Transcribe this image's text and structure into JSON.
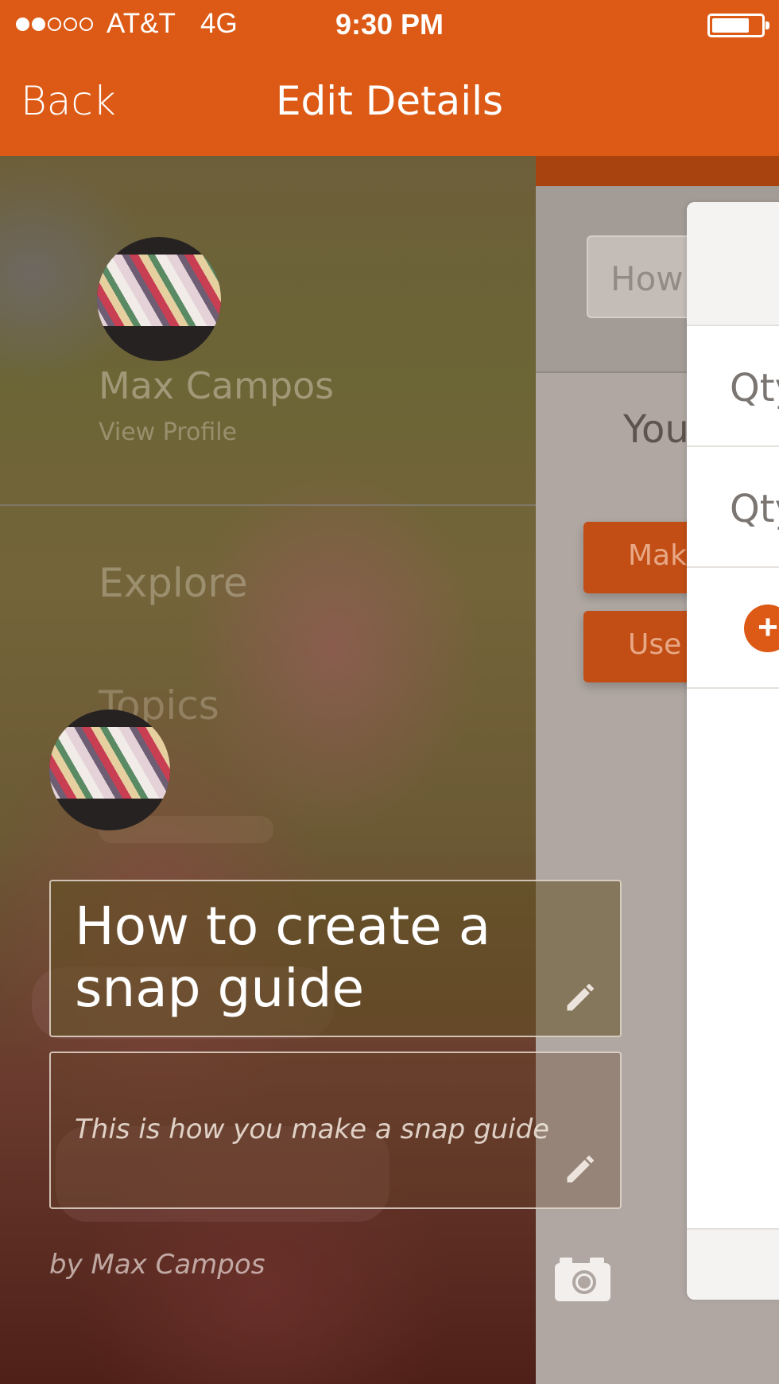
{
  "status_bar": {
    "carrier": "AT&T",
    "network": "4G",
    "time": "9:30 PM",
    "battery_icon": "battery-icon",
    "signal_icon": "signal-dots-icon"
  },
  "nav": {
    "back_label": "Back",
    "title": "Edit Details"
  },
  "drawer": {
    "user_name": "Max Campos",
    "view_profile": "View Profile",
    "items": [
      {
        "label": "Explore"
      },
      {
        "label": "Topics"
      }
    ]
  },
  "underlay": {
    "search_placeholder": "How",
    "partial_text": "You",
    "button_make": "Make",
    "button_use": "Use"
  },
  "panel": {
    "rows": [
      {
        "label": "Qty"
      },
      {
        "label": "Qty"
      }
    ],
    "add_icon": "plus-circle-icon"
  },
  "edit": {
    "title_value": "How to create  a snap guide",
    "description_value": "This is how you make a snap guide",
    "byline": "by Max Campos",
    "edit_icon": "pencil-icon",
    "camera_icon": "camera-icon"
  },
  "colors": {
    "brand": "#dc5a15",
    "button_underlay": "#c24e15",
    "panel_bg": "#ffffff"
  }
}
